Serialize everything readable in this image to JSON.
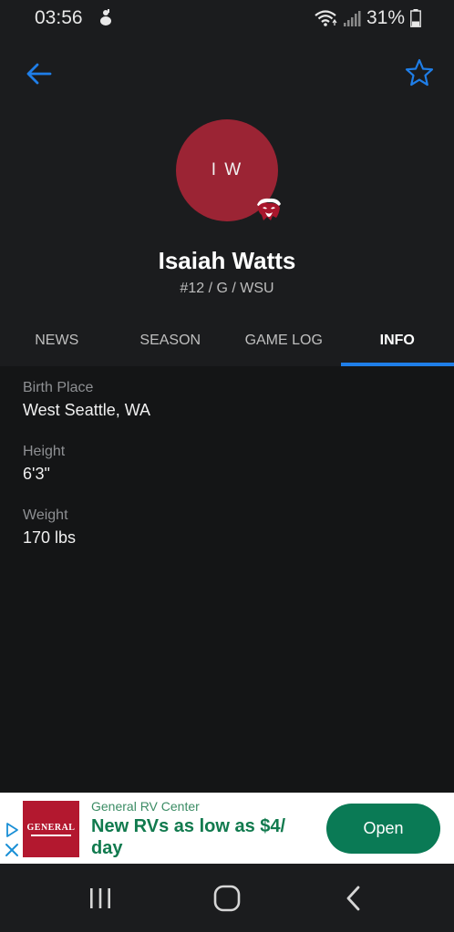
{
  "status_bar": {
    "time": "03:56",
    "battery": "31%",
    "icons": [
      "notification-icon",
      "wifi-icon",
      "signal-icon",
      "battery-icon"
    ]
  },
  "header": {
    "back_icon": "back-arrow-icon",
    "favorite_icon": "star-outline-icon",
    "accent_color": "#1f7ee8"
  },
  "player": {
    "initials": "I W",
    "name": "Isaiah Watts",
    "meta": "#12 / G / WSU",
    "avatar_color": "#9b2434",
    "team_logo": "wsu-cougar-logo"
  },
  "tabs": [
    {
      "label": "NEWS",
      "active": false
    },
    {
      "label": "SEASON",
      "active": false
    },
    {
      "label": "GAME LOG",
      "active": false
    },
    {
      "label": "INFO",
      "active": true
    }
  ],
  "info": [
    {
      "label": "Birth Place",
      "value": "West Seattle, WA"
    },
    {
      "label": "Height",
      "value": "6'3\""
    },
    {
      "label": "Weight",
      "value": "170 lbs"
    }
  ],
  "ad": {
    "logo_text": "GENERAL",
    "brand": "General RV Center",
    "headline": "New RVs as low as $4/ day",
    "cta": "Open",
    "cta_color": "#0a7a55"
  },
  "nav_bar": {
    "icons": [
      "recent-apps-icon",
      "home-icon",
      "back-icon"
    ]
  }
}
